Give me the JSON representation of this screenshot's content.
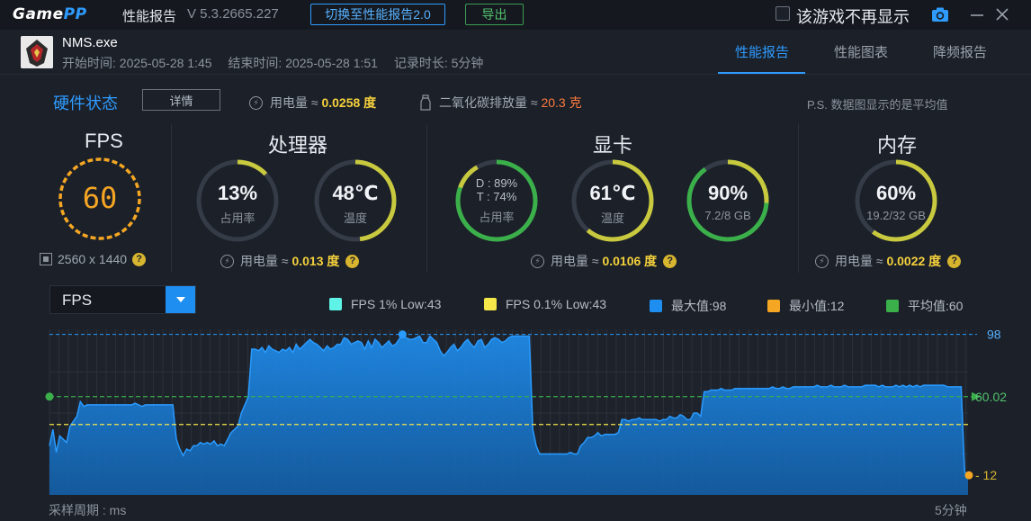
{
  "titlebar": {
    "logo_a": "Game",
    "logo_b": "PP",
    "title": "性能报告",
    "version": "V 5.3.2665.227",
    "switch_btn": "切换至性能报告2.0",
    "export_btn": "导出",
    "dont_show_label": "该游戏不再显示",
    "camera_icon": "camera-icon",
    "accent": "#2f9bff"
  },
  "game": {
    "name": "NMS.exe",
    "start": "开始时间: 2025-05-28 1:45",
    "end": "结束时间: 2025-05-28 1:51",
    "duration": "记录时长: 5分钟"
  },
  "tabs": [
    {
      "label": "性能报告",
      "active": true
    },
    {
      "label": "性能图表",
      "active": false
    },
    {
      "label": "降频报告",
      "active": false
    }
  ],
  "hardware": {
    "title": "硬件状态",
    "detail_btn": "详情",
    "power_label": "用电量 ≈ ",
    "power_value": "0.0258 度",
    "co2_label": "二氧化碳排放量 ≈ ",
    "co2_value": "20.3 克",
    "note": "P.S. 数据图显示的是平均值"
  },
  "fps": {
    "title": "FPS",
    "value": "60",
    "resolution": "2560 x 1440"
  },
  "cpu": {
    "title": "处理器",
    "usage_value": "13%",
    "usage_fraction": 0.13,
    "usage_label": "占用率",
    "temp_value": "48℃",
    "temp_fraction": 0.48,
    "temp_label": "温度",
    "power_label": "用电量 ≈ ",
    "power_value": "0.013 度"
  },
  "gpu": {
    "title": "显卡",
    "d_label": "D : 89%",
    "t_label": "T : 74%",
    "usage_fraction": 0.89,
    "usage_label": "占用率",
    "temp_value": "61℃",
    "temp_fraction": 0.61,
    "temp_label": "温度",
    "mem_value": "90%",
    "mem_fraction": 0.9,
    "mem_sub": "7.2/8 GB",
    "power_label": "用电量 ≈ ",
    "power_value": "0.0106 度"
  },
  "ram": {
    "title": "内存",
    "value": "60%",
    "fraction": 0.6,
    "sub": "19.2/32 GB",
    "power_label": "用电量 ≈ ",
    "power_value": "0.0022 度"
  },
  "chart_select": {
    "value": "FPS"
  },
  "legend": [
    {
      "label": "FPS 1% Low:43",
      "color": "#5ff2e6"
    },
    {
      "label": "FPS 0.1% Low:43",
      "color": "#f5e64a"
    },
    {
      "label": "最大值:98",
      "color": "#1e8ef0"
    },
    {
      "label": "最小值:12",
      "color": "#f5a623"
    },
    {
      "label": "平均值:60",
      "color": "#3bb04a"
    }
  ],
  "chart_footer": {
    "left": "采样周期 : ms",
    "right": "5分钟"
  },
  "chart_data": {
    "type": "area",
    "title": "",
    "ylim": [
      0,
      100
    ],
    "max_label": "98",
    "min_label": "12",
    "avg_label": "60.02",
    "one_percent_low": 43,
    "pct01_low": 43,
    "avg": 60.02,
    "max": 98,
    "min": 12,
    "series": [
      {
        "values": [
          30,
          40,
          26,
          36,
          34,
          32,
          42,
          45,
          48,
          57,
          54,
          55,
          55,
          55,
          55,
          55,
          55,
          55,
          55,
          55,
          55,
          55,
          55,
          55,
          55,
          56,
          55,
          54,
          55,
          55,
          55,
          55,
          55,
          55,
          55,
          55,
          55,
          34,
          28,
          24,
          28,
          27,
          30,
          30,
          32,
          31,
          32,
          31,
          33,
          30,
          31,
          30,
          34,
          38,
          40,
          42,
          50,
          55,
          60,
          89,
          89,
          88,
          90,
          87,
          91,
          89,
          88,
          87,
          89,
          88,
          90,
          87,
          92,
          89,
          91,
          93,
          95,
          93,
          92,
          90,
          88,
          91,
          89,
          90,
          92,
          92,
          96,
          95,
          92,
          93,
          94,
          93,
          89,
          94,
          90,
          95,
          93,
          90,
          92,
          94,
          91,
          92,
          95,
          98,
          96,
          95,
          95,
          96,
          97,
          93,
          93,
          97,
          95,
          93,
          88,
          85,
          87,
          90,
          92,
          88,
          90,
          93,
          95,
          92,
          90,
          94,
          95,
          90,
          92,
          95,
          96,
          95,
          93,
          94,
          96,
          97,
          97,
          97,
          97,
          97,
          97,
          40,
          30,
          25,
          25,
          25,
          25,
          25,
          25,
          25,
          25,
          25,
          26,
          25,
          25,
          30,
          32,
          35,
          35,
          36,
          38,
          36,
          37,
          37,
          37,
          37,
          38,
          46,
          46,
          45,
          46,
          46,
          47,
          46,
          46,
          46,
          46,
          46,
          45,
          46,
          46,
          48,
          47,
          47,
          49,
          48,
          46,
          46,
          50,
          50,
          48,
          63,
          63,
          64,
          64,
          64,
          65,
          64,
          64,
          64,
          65,
          65,
          65,
          65,
          65,
          65,
          65,
          65,
          65,
          65,
          65,
          66,
          65,
          65,
          66,
          65,
          65,
          66,
          66,
          66,
          66,
          66,
          66,
          66,
          67,
          66,
          66,
          66,
          67,
          66,
          66,
          66,
          67,
          66,
          66,
          66,
          66,
          66,
          67,
          67,
          67,
          67,
          66,
          67,
          66,
          66,
          66,
          67,
          66,
          67,
          66,
          67,
          66,
          67,
          66,
          67,
          67,
          67,
          67,
          67,
          67,
          67,
          66,
          66,
          66,
          66,
          66,
          14,
          12
        ]
      }
    ]
  }
}
